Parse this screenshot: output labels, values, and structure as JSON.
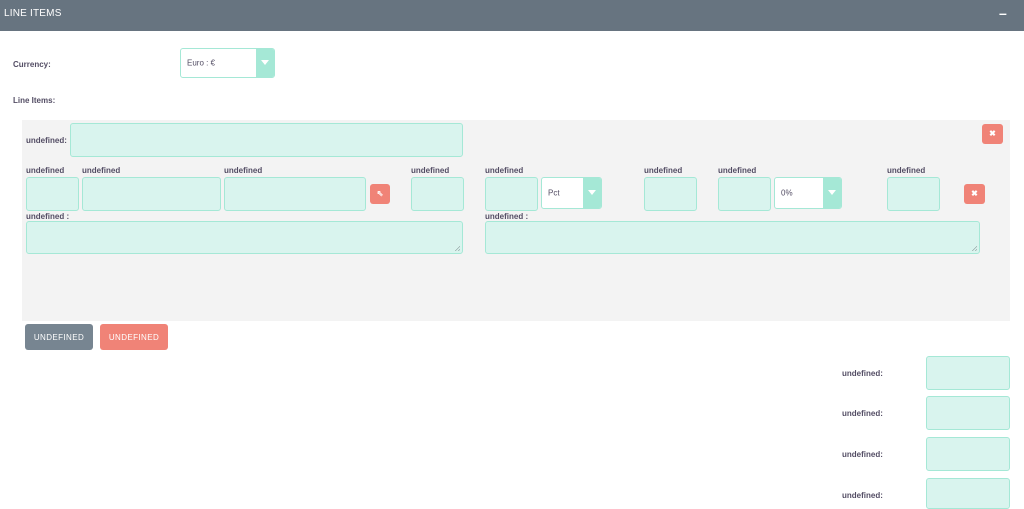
{
  "header": {
    "title": "LINE ITEMS",
    "collapse_icon": "minus-icon"
  },
  "currency": {
    "label": "Currency:",
    "selected": "Euro : €"
  },
  "line_items_label": "Line Items:",
  "group": {
    "name_label": "undefined:",
    "remove_group_icon": "close-icon",
    "columns": [
      "undefined",
      "undefined",
      "undefined",
      "undefined",
      "undefined",
      "undefined",
      "undefined",
      "undefined"
    ],
    "select_product_icon": "arrow-up-left-icon",
    "discount_type": "Pct",
    "tax_rate": "0%",
    "remove_item_icon": "close-icon",
    "description_label": "undefined :",
    "note_label": "undefined :"
  },
  "buttons": {
    "add_line_item": "UNDEFINED",
    "add_group": "UNDEFINED"
  },
  "totals": {
    "labels": [
      "undefined:",
      "undefined:",
      "undefined:",
      "undefined:"
    ]
  },
  "colors": {
    "header": "#677480",
    "field": "#d9f4ee",
    "field_border": "#a5e8d6",
    "danger": "#f08377",
    "secondary": "#778591"
  }
}
